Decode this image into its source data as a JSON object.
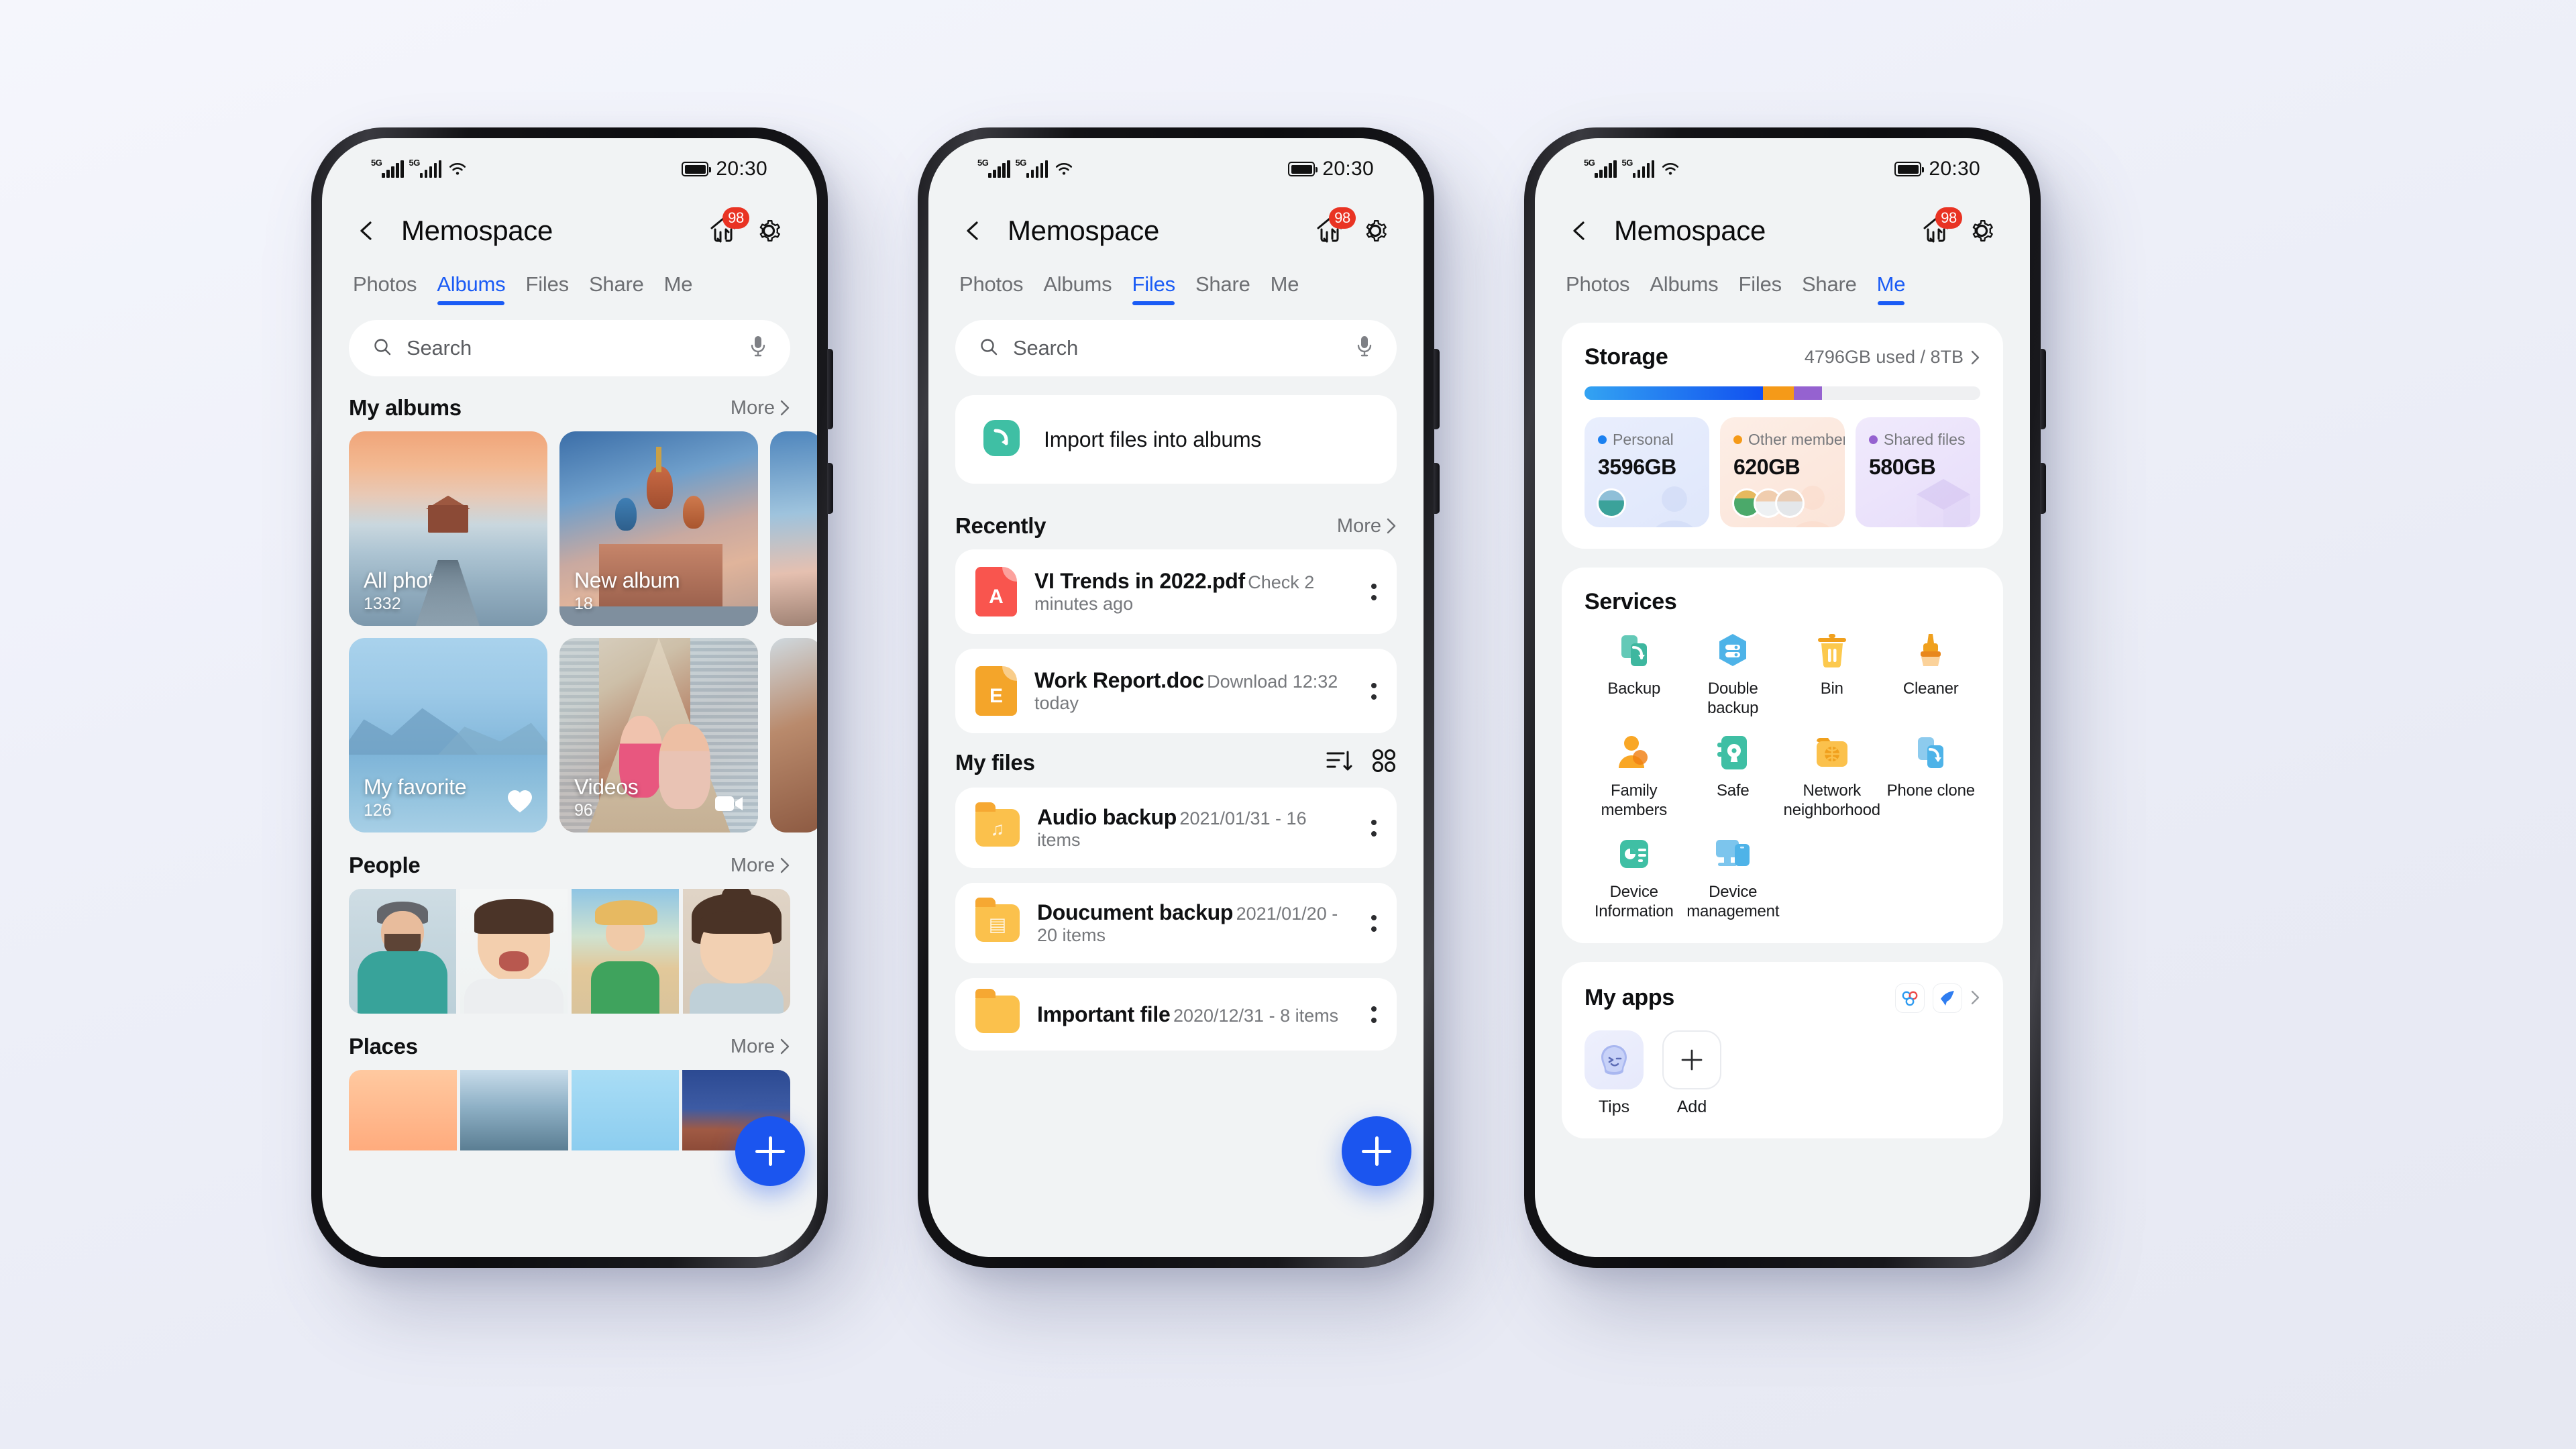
{
  "status_bar": {
    "network": "5G",
    "time": "20:30"
  },
  "header": {
    "title": "Memospace",
    "badge_count": "98",
    "back_icon": "back-arrow-icon",
    "transfer_icon": "transfer-icon",
    "settings_icon": "gear-icon"
  },
  "tabs": [
    "Photos",
    "Albums",
    "Files",
    "Share",
    "Me"
  ],
  "search": {
    "placeholder": "Search",
    "icon": "search-icon",
    "mic_icon": "microphone-icon"
  },
  "common": {
    "more": "More"
  },
  "phone1": {
    "active_tab": "Albums",
    "sections": {
      "my_albums": {
        "title": "My albums",
        "more": "More"
      },
      "people": {
        "title": "People",
        "more": "More"
      },
      "places": {
        "title": "Places",
        "more": "More"
      }
    },
    "albums": [
      {
        "name": "All photos",
        "count": "1332",
        "badge": ""
      },
      {
        "name": "New album",
        "count": "18",
        "badge": ""
      },
      {
        "name": "My favorite",
        "count": "126",
        "badge": "heart-icon"
      },
      {
        "name": "Videos",
        "count": "96",
        "badge": "video-icon"
      }
    ],
    "fab": "add-button"
  },
  "phone2": {
    "active_tab": "Files",
    "import": {
      "label": "Import files into albums",
      "icon": "import-icon"
    },
    "recently": {
      "title": "Recently",
      "more": "More",
      "items": [
        {
          "name": "VI Trends in 2022.pdf",
          "sub": "Check  2 minutes ago",
          "type": "pdf",
          "glyph": "A"
        },
        {
          "name": "Work Report.doc",
          "sub": "Download 12:32 today",
          "type": "doc",
          "glyph": "E"
        }
      ]
    },
    "my_files": {
      "title": "My files",
      "sort_icon": "sort-icon",
      "grid_icon": "grid-view-icon",
      "items": [
        {
          "name": "Audio backup",
          "sub": "2021/01/31 - 16 items",
          "glyph": "♫"
        },
        {
          "name": "Doucument backup",
          "sub": "2021/01/20 - 20 items",
          "glyph": "▤"
        },
        {
          "name": "Important file",
          "sub": "2020/12/31 - 8 items",
          "glyph": ""
        }
      ]
    },
    "fab": "add-button"
  },
  "phone3": {
    "active_tab": "Me",
    "storage": {
      "title": "Storage",
      "used_label": "4796GB used / 8TB",
      "segments": [
        {
          "label": "Personal",
          "value": "3596GB",
          "color": "#1b80f0",
          "pct": 45
        },
        {
          "label": "Other members",
          "value": "620GB",
          "color": "#f59a18",
          "pct": 7.8
        },
        {
          "label": "Shared files",
          "value": "580GB",
          "color": "#9562d0",
          "pct": 7.2
        }
      ]
    },
    "services": {
      "title": "Services",
      "items": [
        {
          "label": "Backup",
          "icon": "backup-icon"
        },
        {
          "label": "Double backup",
          "icon": "double-backup-icon"
        },
        {
          "label": "Bin",
          "icon": "trash-bin-icon"
        },
        {
          "label": "Cleaner",
          "icon": "brush-cleaner-icon"
        },
        {
          "label": "Family members",
          "icon": "family-members-icon"
        },
        {
          "label": "Safe",
          "icon": "safe-lock-icon"
        },
        {
          "label": "Network neighborhood",
          "icon": "network-folder-icon"
        },
        {
          "label": "Phone clone",
          "icon": "phone-clone-icon"
        },
        {
          "label": "Device Information",
          "icon": "device-info-icon"
        },
        {
          "label": "Device management",
          "icon": "device-management-icon"
        }
      ]
    },
    "my_apps": {
      "title": "My apps",
      "items": [
        {
          "label": "Tips",
          "icon": "tips-icon"
        },
        {
          "label": "Add",
          "icon": "plus-icon"
        }
      ]
    }
  }
}
